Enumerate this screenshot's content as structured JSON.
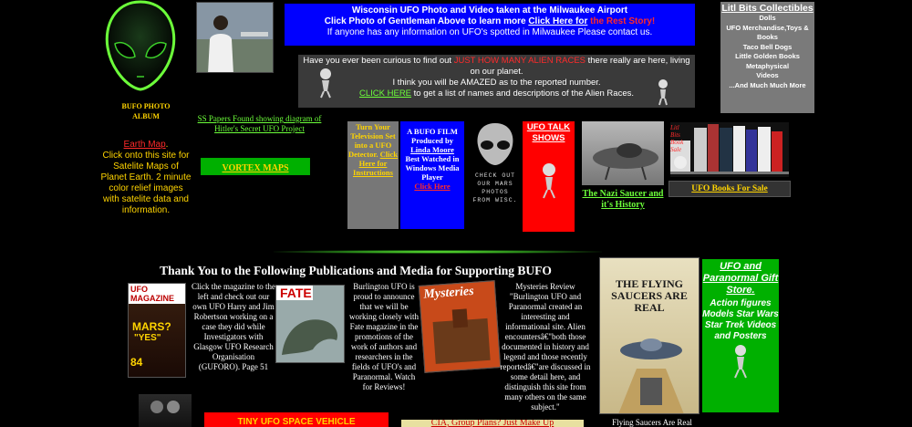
{
  "left": {
    "album_line1": "BUFO PHOTO",
    "album_line2": "ALBUM",
    "earth_map_link": "Earth Map",
    "earth_map_dot": ".",
    "earth_map_desc": "Click onto this site for Satelite Maps of Planet Earth. 2 minute color relief images with satelite data and information."
  },
  "top_banner": {
    "line1": "Wisconsin UFO Photo and Video taken at the Milwaukee Airport",
    "line2_pre": "Click Photo of Gentleman Above to learn more ",
    "line2_link": "Click Here for",
    "line2_red": " the Rest Story!",
    "line3": "If anyone has any information on UFO's spotted in Milwaukee Please contact us."
  },
  "races_box": {
    "line1_pre": "Have you ever been curious to find out ",
    "line1_red": "JUST HOW MANY ALIEN RACES",
    "line1_post": " there really are here, living on our planet.",
    "line2": "I think you will be AMAZED as to the reported number.",
    "line3_link": "CLICK HERE",
    "line3_post": " to get a list of names and descriptions of the Alien Races."
  },
  "litl_bits": {
    "title": "Litl Bits Collectibles",
    "items": [
      "Dolls",
      "UFO Merchandise,Toys & Books",
      "Taco Bell Dogs",
      "Little Golden Books",
      "Metaphysical",
      "Videos",
      "...And Much Much More"
    ]
  },
  "ss_papers": "SS Papers Found showing diagram of Hitler's Secret UFO Project",
  "vortex": "VORTEX MAPS",
  "tv_box": {
    "text": "Turn Your Television Set into a UFO Detector. ",
    "link": "Click Here for Instructions"
  },
  "film_box": {
    "l1": "A BUFO FILM",
    "l2": "Produced by",
    "link": "Linda Moore",
    "l3": "Best Watched in Windows Media Player",
    "red": "Click Here"
  },
  "check_mars": "CHECK OUT OUR MARS PHOTOS FROM WISC.",
  "ufo_talk": "UFO TALK SHOWS",
  "nazi_saucer": "The Nazi Saucer and it's History",
  "books_sign": "Litl Bits Book Sale",
  "ufo_books": "UFO Books For Sale",
  "thanks_heading": "Thank You to the Following Publications and Media for Supporting BUFO",
  "ufo_magazine": {
    "cover_title": "UFO MAGAZINE",
    "cover_mars": "MARS?",
    "cover_yes": "\"YES\"",
    "cover_issue": "84",
    "text": "Click the magazine to the left and check out our own UFO Harry and Jim Robertson working on a case they did while Investigators with Glasgow UFO Research Organisation (GUFORO). Page 51"
  },
  "fate": {
    "cover": "FATE",
    "text": "Burlington UFO is proud to announce that we will be working closely with Fate magazine in the promotions of the work of authors and researchers in the fields of UFO's and Paranormal. Watch for Reviews!"
  },
  "mysteries": {
    "cover": "Mysteries",
    "text": "Mysteries Review \"Burlington UFO and Paranormal  created an interesting and informational site. Alien encountersâ€\"both those documented in history and legend and those recently reportedâ€\"are discussed in some detail here, and distinguish this site from many others on the same subject.\""
  },
  "flying_saucers": {
    "title": "THE FLYING SAUCERS ARE REAL",
    "caption": "Flying Saucers Are Real"
  },
  "gift_store": {
    "link": "UFO and Paranormal Gift Store.",
    "items": "Action figures Models Star Wars Star Trek Videos and Posters"
  },
  "tiny_ufo": "TINY UFO SPACE VEHICLE",
  "bottom_cut": "CIA, Group Plans? Just Make Up"
}
